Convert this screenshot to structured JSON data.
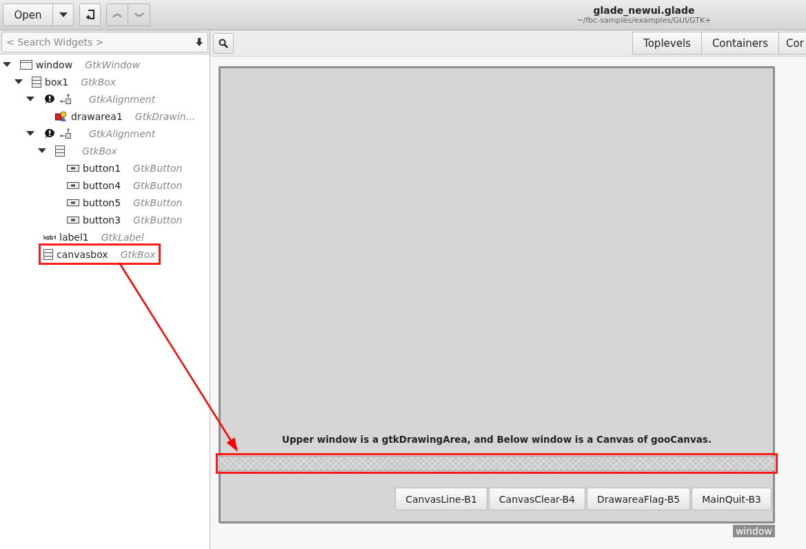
{
  "toolbar": {
    "open_button": "Open",
    "undo": {
      "disabled": true
    },
    "redo": {
      "disabled": true
    }
  },
  "title": "glade_newui.glade",
  "subtitle": "~/fbc-samples/examples/GUI/GTK+",
  "search": {
    "placeholder": "< Search Widgets >"
  },
  "tree": [
    {
      "name": "window",
      "type": "GtkWindow",
      "kind": "window",
      "warning": false,
      "highlighted": false,
      "expanded": true,
      "children": [
        {
          "name": "box1",
          "type": "GtkBox",
          "kind": "box",
          "warning": false,
          "highlighted": false,
          "expanded": true,
          "children": [
            {
              "type": "GtkAlignment",
              "kind": "alignment",
              "warning": true,
              "highlighted": false,
              "expanded": true,
              "children": [
                {
                  "name": "drawarea1",
                  "type": "GtkDrawin…",
                  "kind": "drawing",
                  "warning": false,
                  "highlighted": false
                }
              ]
            },
            {
              "type": "GtkAlignment",
              "kind": "alignment",
              "warning": true,
              "highlighted": false,
              "expanded": true,
              "children": [
                {
                  "type": "GtkBox",
                  "kind": "box",
                  "warning": false,
                  "highlighted": false,
                  "expanded": true,
                  "children": [
                    {
                      "name": "button1",
                      "type": "GtkButton",
                      "kind": "button",
                      "warning": false,
                      "highlighted": false
                    },
                    {
                      "name": "button4",
                      "type": "GtkButton",
                      "kind": "button",
                      "warning": false,
                      "highlighted": false
                    },
                    {
                      "name": "button5",
                      "type": "GtkButton",
                      "kind": "button",
                      "warning": false,
                      "highlighted": false
                    },
                    {
                      "name": "button3",
                      "type": "GtkButton",
                      "kind": "button",
                      "warning": false,
                      "highlighted": false
                    }
                  ]
                }
              ]
            },
            {
              "name": "label1",
              "type": "GtkLabel",
              "kind": "label",
              "warning": false,
              "highlighted": false
            },
            {
              "name": "canvasbox",
              "type": "GtkBox",
              "kind": "box",
              "warning": false,
              "highlighted": true
            }
          ]
        }
      ]
    }
  ],
  "palette_tabs": [
    {
      "label": "Toplevels"
    },
    {
      "label": "Containers"
    },
    {
      "label": "Cor"
    }
  ],
  "design": {
    "label": "Upper window is a gtkDrawingArea, and Below window is a Canvas of gooCanvas.",
    "canvas_highlighted": true,
    "buttons": [
      "CanvasLine-B1",
      "CanvasClear-B4",
      "DrawareaFlag-B5",
      "MainQuit-B3"
    ],
    "window_tag": "window"
  }
}
